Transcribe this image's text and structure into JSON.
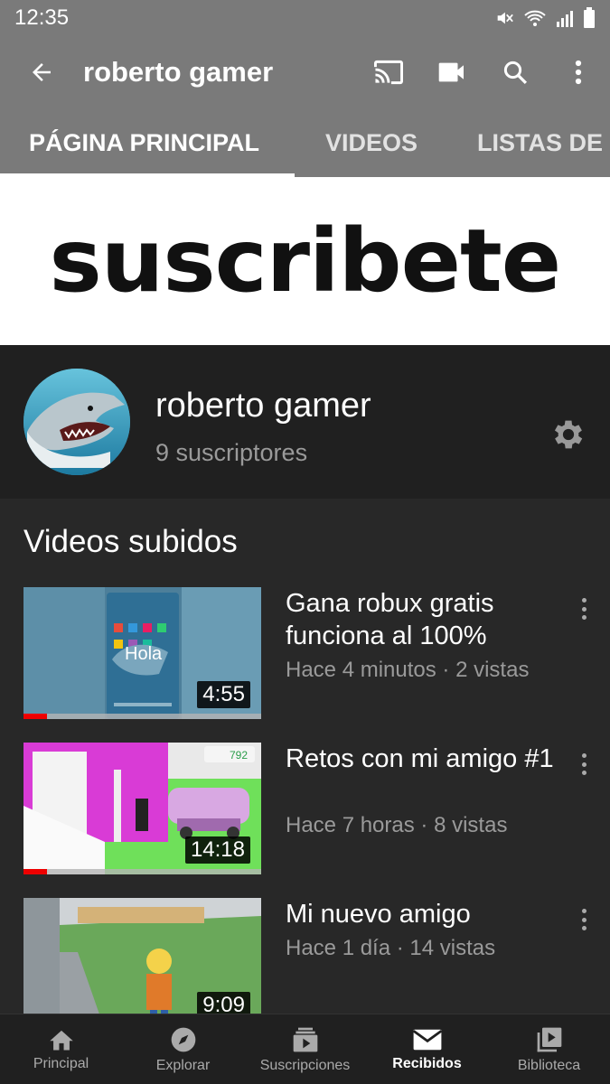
{
  "status_bar": {
    "time": "12:35",
    "icons": [
      "mute-icon",
      "wifi-icon",
      "signal-icon",
      "battery-icon"
    ]
  },
  "app_bar": {
    "title": "roberto gamer",
    "actions": [
      "cast-icon",
      "camera-icon",
      "search-icon",
      "more-icon"
    ]
  },
  "tabs": [
    {
      "label": "PÁGINA PRINCIPAL",
      "active": true
    },
    {
      "label": "VIDEOS",
      "active": false
    },
    {
      "label": "LISTAS DE",
      "active": false
    }
  ],
  "banner": {
    "text": "suscribete"
  },
  "channel": {
    "name": "roberto gamer",
    "subscribers": "9 suscriptores"
  },
  "section": {
    "title": "Videos subidos"
  },
  "videos": [
    {
      "title": "Gana robux gratis funciona al 100%",
      "meta": "Hace 4 minutos · 2 vistas",
      "duration": "4:55",
      "progress": 0.1,
      "thumb_text": "Hola"
    },
    {
      "title": "Retos con mi amigo #1",
      "meta": "Hace 7 horas · 8 vistas",
      "duration": "14:18",
      "progress": 0.1,
      "thumb_text": "792"
    },
    {
      "title": "Mi nuevo amigo",
      "meta": "Hace 1 día · 14 vistas",
      "duration": "9:09",
      "progress": 0
    }
  ],
  "bottom_nav": [
    {
      "label": "Principal",
      "icon": "home-icon",
      "active": false
    },
    {
      "label": "Explorar",
      "icon": "compass-icon",
      "active": false
    },
    {
      "label": "Suscripciones",
      "icon": "subscriptions-icon",
      "active": false
    },
    {
      "label": "Recibidos",
      "icon": "inbox-icon",
      "active": true
    },
    {
      "label": "Biblioteca",
      "icon": "library-icon",
      "active": false
    }
  ],
  "colors": {
    "bar": "#7a7a7a",
    "background": "#282828",
    "header": "#202020",
    "accent": "#e00000"
  }
}
